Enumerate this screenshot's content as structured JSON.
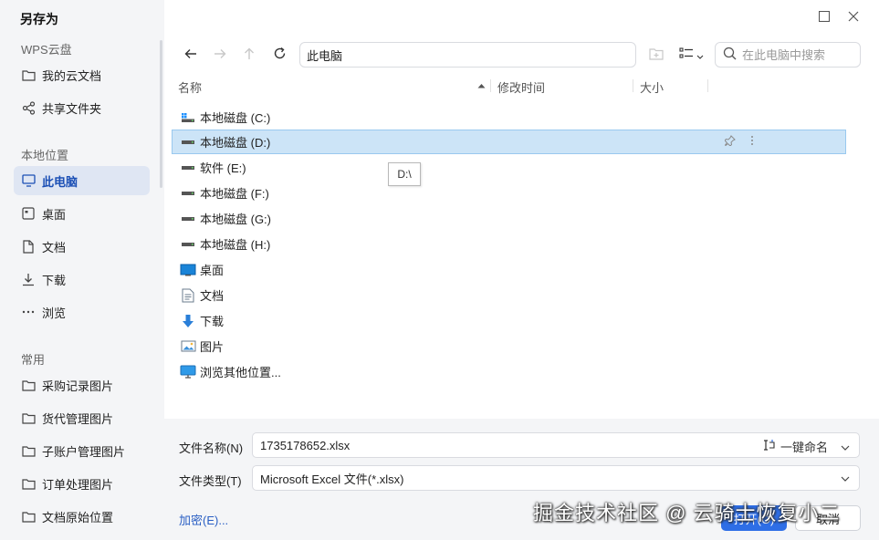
{
  "dialog": {
    "title": "另存为"
  },
  "sidebar": {
    "sections": [
      {
        "label": "WPS云盘"
      },
      {
        "label": "本地位置"
      },
      {
        "label": "常用"
      }
    ],
    "items": [
      {
        "label": "我的云文档",
        "icon": "folder-icon"
      },
      {
        "label": "共享文件夹",
        "icon": "share-icon"
      },
      {
        "label": "此电脑",
        "icon": "computer-icon",
        "active": true
      },
      {
        "label": "桌面",
        "icon": "desktop-icon"
      },
      {
        "label": "文档",
        "icon": "document-icon"
      },
      {
        "label": "下载",
        "icon": "download-icon"
      },
      {
        "label": "浏览",
        "icon": "more-icon"
      },
      {
        "label": "采购记录图片",
        "icon": "folder-icon"
      },
      {
        "label": "货代管理图片",
        "icon": "folder-icon"
      },
      {
        "label": "子账户管理图片",
        "icon": "folder-icon"
      },
      {
        "label": "订单处理图片",
        "icon": "folder-icon"
      },
      {
        "label": "文档原始位置",
        "icon": "folder-icon"
      }
    ]
  },
  "toolbar": {
    "address": "此电脑",
    "search_placeholder": "在此电脑中搜索"
  },
  "columns": {
    "name": "名称",
    "modified": "修改时间",
    "size": "大小"
  },
  "files": [
    {
      "label": "本地磁盘 (C:)",
      "icon": "system-drive-icon"
    },
    {
      "label": "本地磁盘 (D:)",
      "icon": "drive-icon",
      "selected": true
    },
    {
      "label": "软件 (E:)",
      "icon": "drive-icon"
    },
    {
      "label": "本地磁盘 (F:)",
      "icon": "drive-icon"
    },
    {
      "label": "本地磁盘 (G:)",
      "icon": "drive-icon"
    },
    {
      "label": "本地磁盘 (H:)",
      "icon": "drive-icon"
    },
    {
      "label": "桌面",
      "icon": "desktop-folder-icon"
    },
    {
      "label": "文档",
      "icon": "documents-folder-icon"
    },
    {
      "label": "下载",
      "icon": "download-arrow-icon"
    },
    {
      "label": "图片",
      "icon": "pictures-folder-icon"
    },
    {
      "label": "浏览其他位置...",
      "icon": "monitor-icon"
    }
  ],
  "tooltip": "D:\\",
  "bottom": {
    "filename_label": "文件名称(N)",
    "filename_value": "1735178652.xlsx",
    "rename_label": "一键命名",
    "filetype_label": "文件类型(T)",
    "filetype_value": "Microsoft Excel 文件(*.xlsx)",
    "encrypt_label": "加密(E)...",
    "open_label": "打开(O)",
    "cancel_label": "取消"
  },
  "watermark": "掘金技术社区 @ 云骑士恢复小二",
  "colors": {
    "accent": "#2e6ee6",
    "selection": "#cce4f7",
    "sidebar_active": "#dfe6f3"
  }
}
